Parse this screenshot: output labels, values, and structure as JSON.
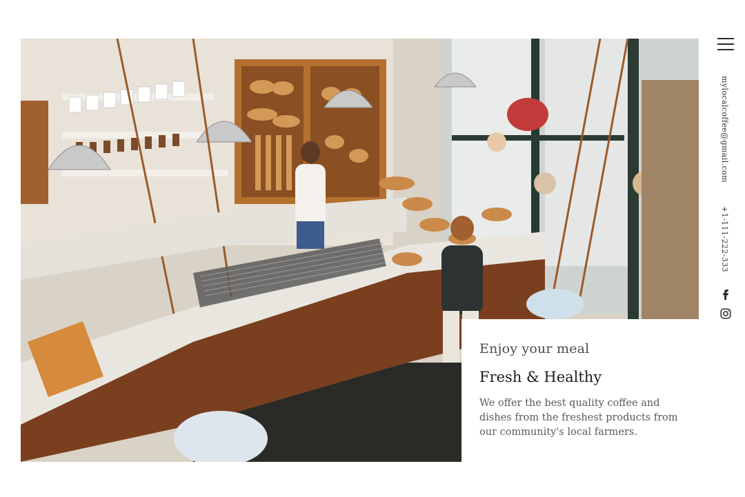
{
  "hero": {
    "alt": "Overhead view of a bakery café counter"
  },
  "card": {
    "eyebrow": "Enjoy your meal",
    "title": "Fresh & Healthy",
    "description": "We offer the best quality coffee and dishes from the freshest products from our community's local farmers."
  },
  "rail": {
    "email": "mylocalcoffee@gmail.com",
    "phone": "+1-111-222-333",
    "icons": [
      "menu-icon",
      "facebook-icon",
      "instagram-icon"
    ]
  },
  "colors": {
    "text_dark": "#1c1c1c",
    "text_muted": "#5a5a5a",
    "wood": "#8a4f2b"
  }
}
